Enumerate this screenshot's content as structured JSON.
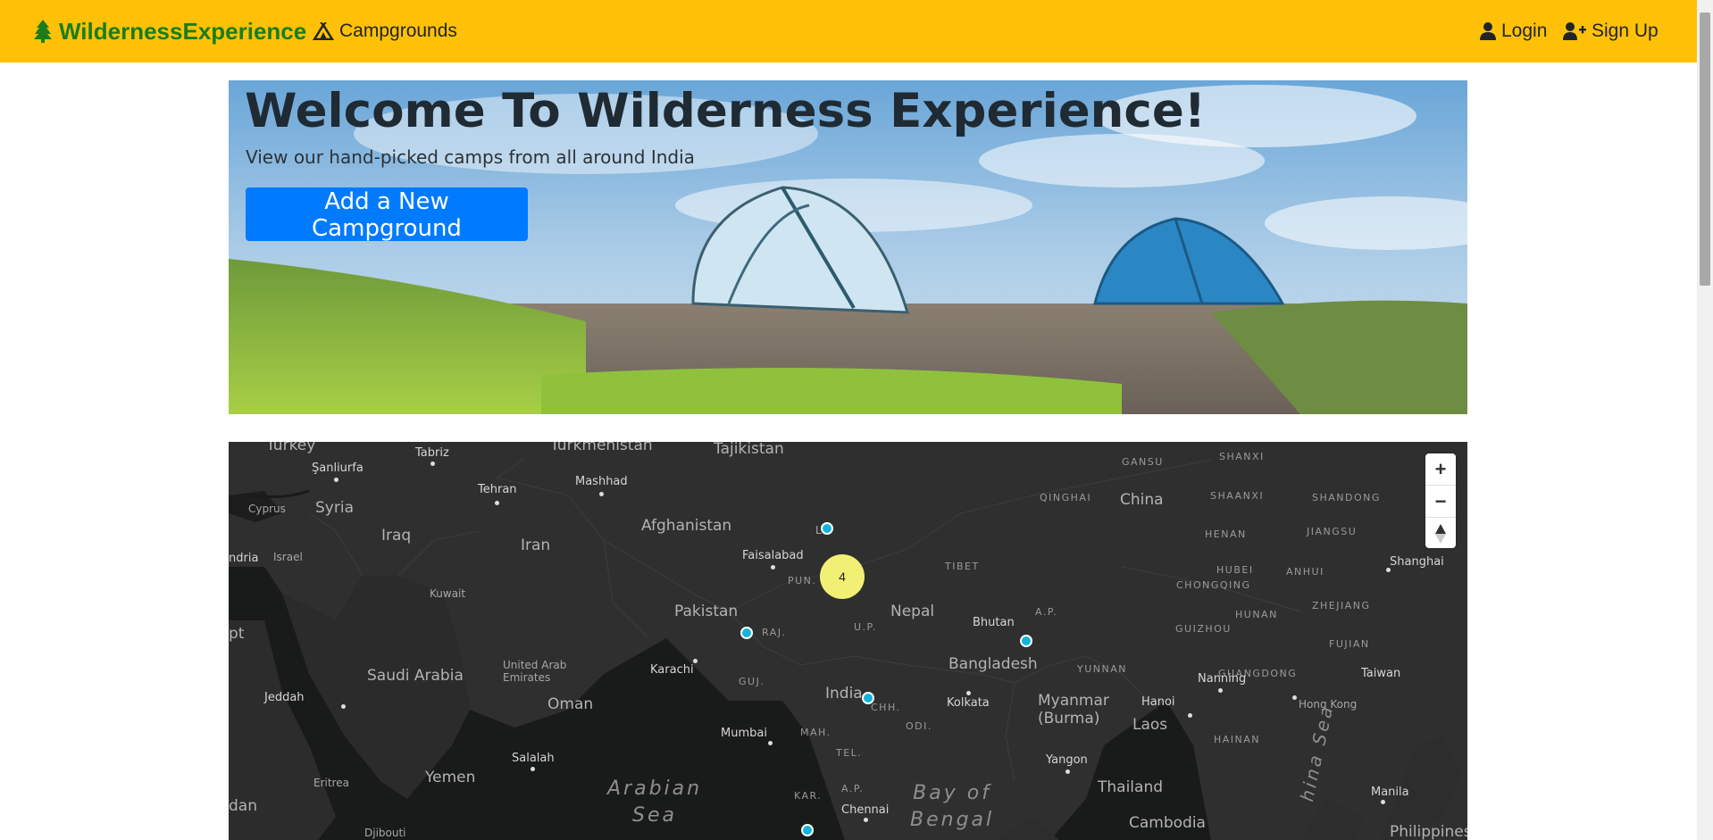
{
  "navbar": {
    "brand": "WildernessExperience",
    "campgrounds": "Campgrounds",
    "login": "Login",
    "signup": "Sign Up"
  },
  "hero": {
    "title": "Welcome To Wilderness Experience!",
    "subtitle": "View our hand-picked camps from all around India",
    "button": "Add a New Campground"
  },
  "map": {
    "cluster_count": "4",
    "controls": {
      "zoom_in": "+",
      "zoom_out": "−",
      "compass": "▲"
    },
    "labels": {
      "turkey": "Turkey",
      "tabriz": "Tabriz",
      "turkmenistan": "Turkmenistan",
      "tajikistan": "Tajikistan",
      "sanliurfa": "Şanliurfa",
      "tehran": "Tehran",
      "mashhad": "Mashhad",
      "gansu": "GANSU",
      "shanxi": "SHANXI",
      "cyprus": "Cyprus",
      "syria": "Syria",
      "qinghai": "QINGHAI",
      "china": "China",
      "shaanxi": "SHAANXI",
      "shandong": "SHANDONG",
      "iraq": "Iraq",
      "afghanistan": "Afghanistan",
      "henan": "HENAN",
      "jiangsu": "JIANGSU",
      "andria": "ndria",
      "israel": "Israel",
      "iran": "Iran",
      "faisalabad": "Faisalabad",
      "tibet": "TIBET",
      "hubei": "HUBEI",
      "anhui": "ANHUI",
      "shanghai": "Shanghai",
      "kuwait": "Kuwait",
      "pun": "PUN.",
      "chongqing": "CHONGQING",
      "zhejiang": "ZHEJIANG",
      "pakistan": "Pakistan",
      "nepal": "Nepal",
      "ap": "A.P.",
      "hunan": "HUNAN",
      "egypt": "pt",
      "raj": "RAJ.",
      "up": "U.P.",
      "bhutan": "Bhutan",
      "guizhou": "GUIZHOU",
      "fujian": "FUJIAN",
      "saudi": "Saudi Arabia",
      "uae": "United Arab\nEmirates",
      "karachi": "Karachi",
      "bangladesh": "Bangladesh",
      "yunnan": "YUNNAN",
      "guangdong": "GUANGDONG",
      "taiwan": "Taiwan",
      "guj": "GUJ.",
      "india": "India",
      "chh": "CHH.",
      "kolkata": "Kolkata",
      "myanmar": "Myanmar\n(Burma)",
      "nanning": "Nanning",
      "hanoi": "Hanoi",
      "hongkong": "Hong Kong",
      "jeddah": "Jeddah",
      "oman": "Oman",
      "mumbai": "Mumbai",
      "odi": "ODI.",
      "laos": "Laos",
      "mah": "MAH.",
      "hainan": "HAINAN",
      "salalah": "Salalah",
      "tel": "TEL.",
      "yangon": "Yangon",
      "yemen": "Yemen",
      "arabian_sea": "Arabian\nSea",
      "thailand": "Thailand",
      "southchinasea": "hina Sea",
      "eritrea": "Eritrea",
      "kar": "KAR.",
      "ap2": "A.P.",
      "bay_of_bengal": "Bay of\nBengal",
      "manila": "Manila",
      "chennai": "Chennai",
      "sudan": "dan",
      "djibouti": "Djibouti",
      "cambodia": "Cambodia",
      "philippines": "Philippines",
      "leh": "Le"
    }
  }
}
